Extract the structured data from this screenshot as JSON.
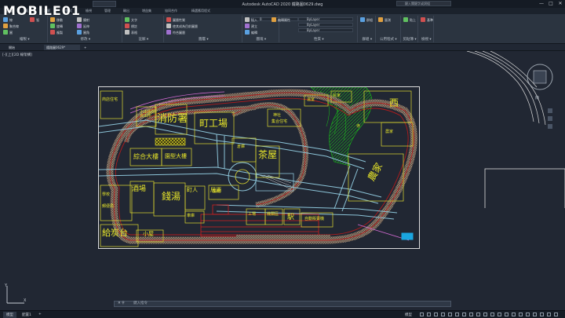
{
  "app": {
    "title": "Autodesk AutoCAD 2020  鐵路圖0629.dwg",
    "search_placeholder": "鍵入關鍵字或詞組",
    "win_minimize": "—",
    "win_maximize": "□",
    "win_close": "✕"
  },
  "watermark": {
    "text": "MOBILE01"
  },
  "ribbon": {
    "tabs": [
      "預設",
      "插入",
      "註解",
      "參數式",
      "檢視",
      "管理",
      "輸出",
      "增益集",
      "協同合作",
      "精選應用程式"
    ],
    "panels": [
      {
        "title": "繪製",
        "items": [
          "線",
          "聚合線",
          "圓",
          "弧"
        ]
      },
      {
        "title": "修改",
        "items": [
          "移動",
          "旋轉",
          "複製",
          "鏡射",
          "延伸",
          "圓角"
        ]
      },
      {
        "title": "註解",
        "items": [
          "文字",
          "標註",
          "表格"
        ]
      },
      {
        "title": "圖層",
        "items": [
          "圖層性質",
          "使其成為目前圖層",
          "符合圖層"
        ]
      },
      {
        "title": "圖塊",
        "items": [
          "插入",
          "建立",
          "編輯",
          "編輯屬性"
        ]
      },
      {
        "title": "性質",
        "items": [
          "ByLayer",
          "ByLayer",
          "ByLayer"
        ]
      },
      {
        "title": "群組",
        "items": [
          "群組"
        ]
      },
      {
        "title": "公用程式",
        "items": [
          "量測"
        ]
      },
      {
        "title": "剪貼簿",
        "items": [
          "貼上"
        ]
      },
      {
        "title": "檢視",
        "items": [
          "基準"
        ]
      }
    ],
    "layer_dropdown": "0",
    "bylayer": [
      "ByLayer",
      "ByLayer",
      "ByLayer"
    ]
  },
  "file_tabs": [
    "開始",
    "鐵路圖0629*"
  ],
  "add_tab": "+",
  "viewport": {
    "label": "[-][上][2D 線架構]"
  },
  "drawing": {
    "labels": [
      {
        "key": "shop",
        "text": "商店住宅",
        "size": 5
      },
      {
        "key": "firehouse",
        "text": "消防署",
        "size": 13
      },
      {
        "key": "smalloffice",
        "text": "小出張所\n派出所",
        "size": 5
      },
      {
        "key": "factory",
        "text": "町工場",
        "size": 12
      },
      {
        "key": "teahouse",
        "text": "茶屋",
        "size": 12
      },
      {
        "key": "comprehensive",
        "text": "綜合大樓",
        "size": 8
      },
      {
        "key": "mall",
        "text": "園型大樓",
        "size": 7
      },
      {
        "key": "mdrink",
        "text": "酒場",
        "size": 9
      },
      {
        "key": "citystreet",
        "text": "町人",
        "size": 7
      },
      {
        "key": "bath",
        "text": "錢湯",
        "size": 12
      },
      {
        "key": "tavern",
        "text": "居酒",
        "size": 7
      },
      {
        "key": "coalplatform",
        "text": "給炭台",
        "size": 11
      },
      {
        "key": "small",
        "text": "小屋",
        "size": 7
      },
      {
        "key": "west",
        "text": "西",
        "size": 12
      },
      {
        "key": "farm",
        "text": "農家",
        "size": 12
      },
      {
        "key": "station",
        "text": "駅",
        "size": 9
      },
      {
        "key": "greenhouse",
        "text": "温室",
        "size": 5
      },
      {
        "key": "house1",
        "text": "民家",
        "size": 5
      },
      {
        "key": "house2",
        "text": "農家",
        "size": 5
      },
      {
        "key": "factory2",
        "text": "工場",
        "size": 5
      },
      {
        "key": "vendor",
        "text": "自動販賣機",
        "size": 5
      },
      {
        "key": "depot",
        "text": "機關區",
        "size": 5
      },
      {
        "key": "warehouse",
        "text": "倉庫",
        "size": 5
      },
      {
        "key": "shrine",
        "text": "神社",
        "size": 5
      },
      {
        "key": "school",
        "text": "學校",
        "size": 5
      },
      {
        "key": "post",
        "text": "郵便局",
        "size": 5
      },
      {
        "key": "shed",
        "text": "車庫",
        "size": 5
      },
      {
        "key": "clinic",
        "text": "醫院",
        "size": 5
      },
      {
        "key": "apartment",
        "text": "集合住宅",
        "size": 5
      },
      {
        "key": "temple",
        "text": "寺",
        "size": 5
      }
    ]
  },
  "command": {
    "placeholder": "鍵入指令"
  },
  "status": {
    "tabs": [
      "模型",
      "配置1",
      "配置2"
    ],
    "add": "+",
    "model_label": "模型"
  },
  "colors": {
    "rail": "#b21c1c",
    "ballast": "#7a6a5a",
    "road": "#8cc4d8",
    "label": "#e8e62a",
    "grass": "#19c419",
    "frame": "#dcdcdc",
    "background": "#212733"
  }
}
